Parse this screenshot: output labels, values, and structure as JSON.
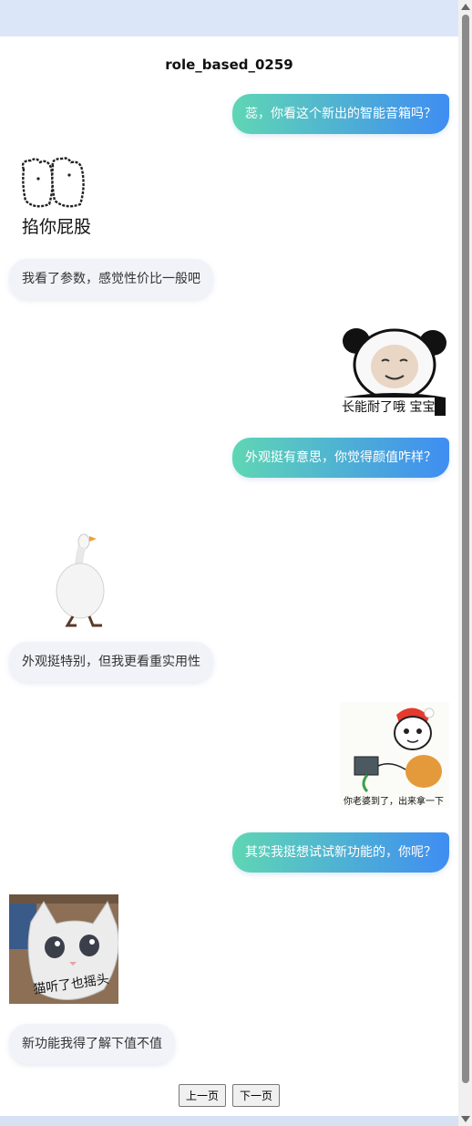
{
  "chat": {
    "title": "role_based_0259",
    "messages": [
      {
        "side": "right",
        "type": "text",
        "text": "蕊，你看这个新出的智能音箱吗？"
      },
      {
        "side": "left",
        "type": "sticker",
        "icon": "bear-sticker-icon",
        "caption": "掐你屁股"
      },
      {
        "side": "left",
        "type": "text",
        "text": "我看了参数，感觉性价比一般吧"
      },
      {
        "side": "right",
        "type": "sticker",
        "icon": "panda-sticker-icon",
        "caption": "长能耐了哦 宝宝"
      },
      {
        "side": "right",
        "type": "text",
        "text": "外观挺有意思，你觉得颜值咋样？"
      },
      {
        "side": "left",
        "type": "sticker",
        "icon": "goose-sticker-icon",
        "caption": ""
      },
      {
        "side": "left",
        "type": "text",
        "text": "外观挺特别，但我更看重实用性"
      },
      {
        "side": "right",
        "type": "sticker",
        "icon": "santa-panda-sticker-icon",
        "caption": "你老婆到了，出来拿一下"
      },
      {
        "side": "right",
        "type": "text",
        "text": "其实我挺想试试新功能的，你呢？"
      },
      {
        "side": "left",
        "type": "sticker",
        "icon": "cat-sticker-icon",
        "caption": "猫听了也摇头"
      },
      {
        "side": "left",
        "type": "text",
        "text": "新功能我得了解下值不值"
      }
    ]
  },
  "pager": {
    "prev_label": "上一页",
    "next_label": "下一页"
  },
  "colors": {
    "bubble_right_start": "#5fd6b4",
    "bubble_right_end": "#3f8df2",
    "bubble_left": "#f1f3f8"
  }
}
